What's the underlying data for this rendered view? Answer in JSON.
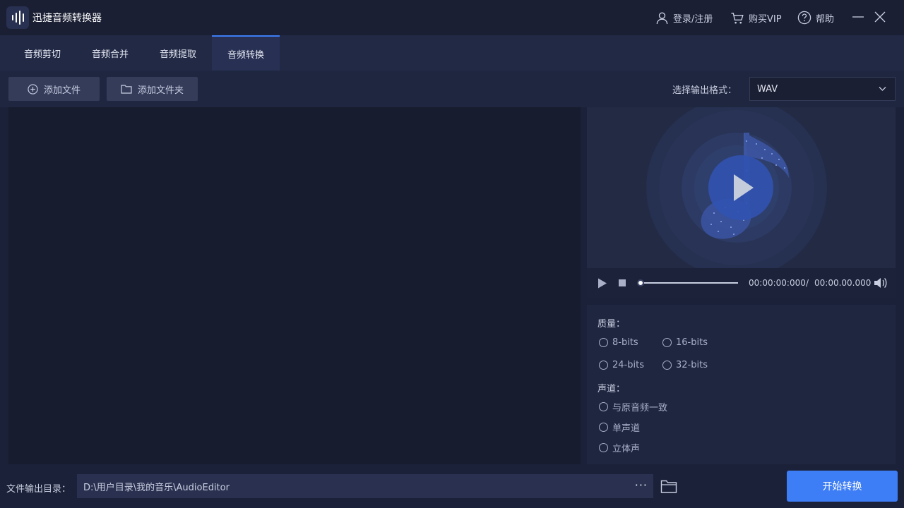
{
  "app": {
    "title": "迅捷音频转换器"
  },
  "titlebar": {
    "login": "登录/注册",
    "vip": "购买VIP",
    "help": "帮助"
  },
  "tabs": [
    {
      "label": "音频剪切"
    },
    {
      "label": "音频合并"
    },
    {
      "label": "音频提取"
    },
    {
      "label": "音频转换",
      "active": true
    }
  ],
  "toolbar": {
    "add_file": "添加文件",
    "add_folder": "添加文件夹"
  },
  "format": {
    "label": "选择输出格式：",
    "value": "WAV"
  },
  "player": {
    "current": "00:00:00:000",
    "sep": "/",
    "total": "00:00.00.000",
    "progress": 0
  },
  "settings": {
    "quality_label": "质量：",
    "quality_options": [
      "8-bits",
      "16-bits",
      "24-bits",
      "32-bits"
    ],
    "channel_label": "声道：",
    "channel_options": [
      "与原音频一致",
      "单声道",
      "立体声"
    ]
  },
  "output": {
    "label": "文件输出目录：",
    "path": "D:\\用户目录\\我的音乐\\AudioEditor",
    "more": "···"
  },
  "convert": {
    "label": "开始转换"
  },
  "colors": {
    "accent": "#3d7df5",
    "background": "#1b2138",
    "panel": "#171c2f"
  }
}
